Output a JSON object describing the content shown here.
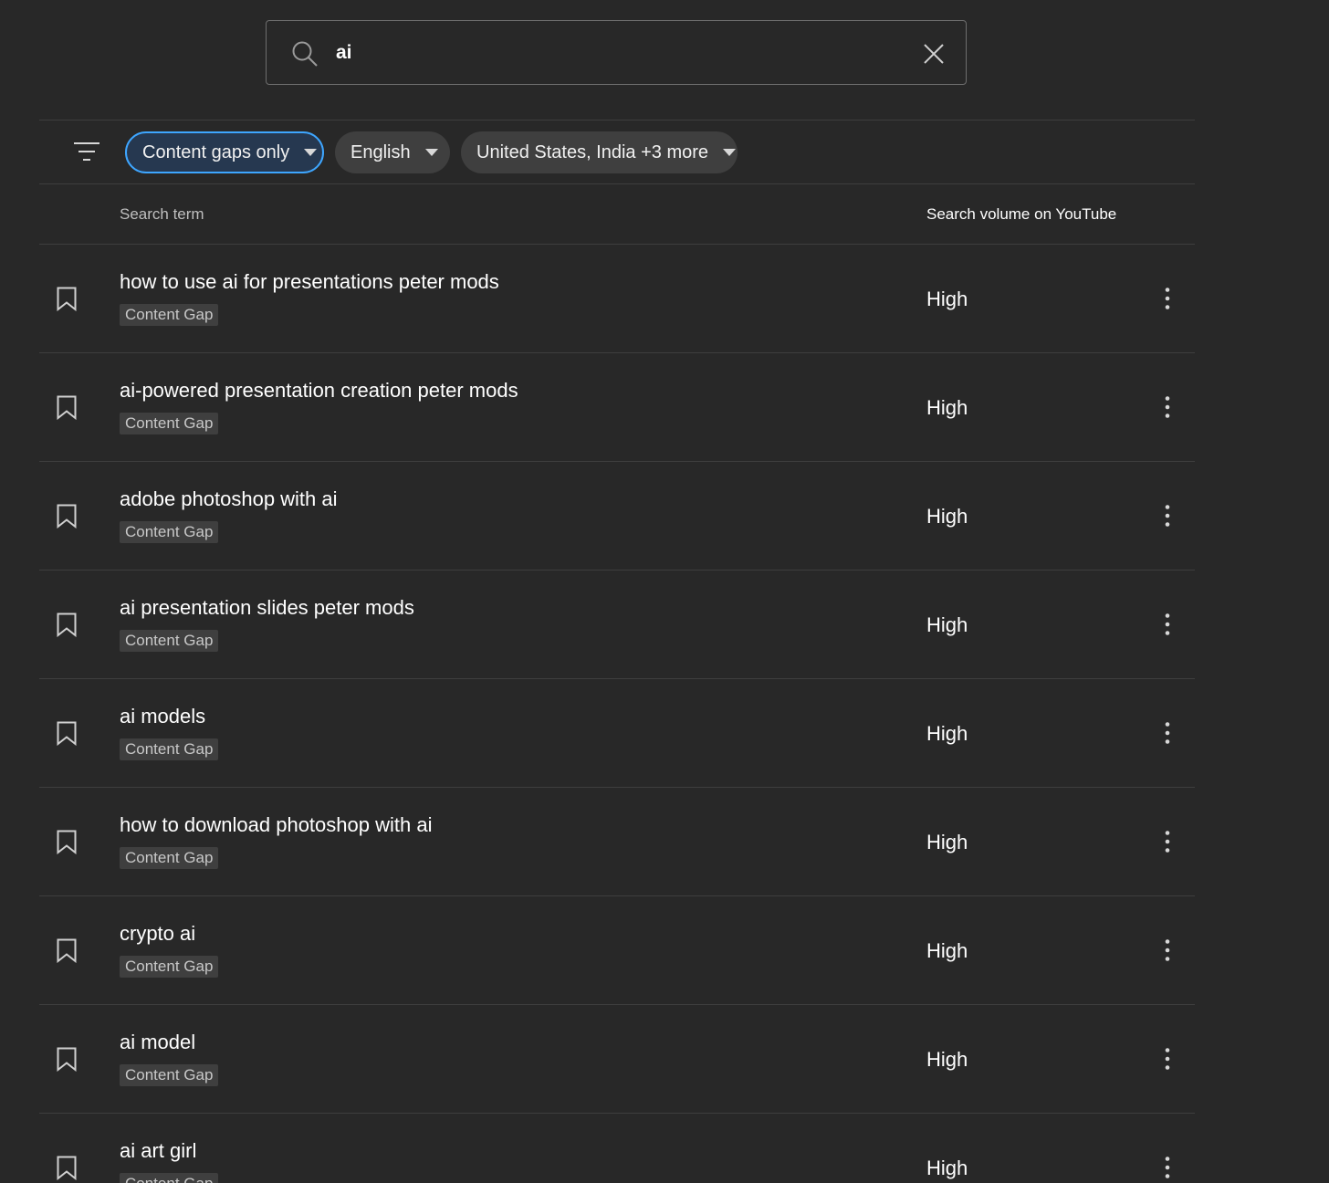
{
  "search": {
    "value": "ai",
    "placeholder": ""
  },
  "filters": {
    "chips": [
      {
        "label": "Content gaps only",
        "active": true
      },
      {
        "label": "English",
        "active": false
      },
      {
        "label": "United States, India +3 more",
        "active": false
      }
    ]
  },
  "table": {
    "columns": {
      "term": "Search term",
      "volume": "Search volume on YouTube"
    },
    "rows": [
      {
        "term": "how to use ai for presentations peter mods",
        "badge": "Content Gap",
        "volume": "High"
      },
      {
        "term": "ai-powered presentation creation peter mods",
        "badge": "Content Gap",
        "volume": "High"
      },
      {
        "term": "adobe photoshop with ai",
        "badge": "Content Gap",
        "volume": "High"
      },
      {
        "term": "ai presentation slides peter mods",
        "badge": "Content Gap",
        "volume": "High"
      },
      {
        "term": "ai models",
        "badge": "Content Gap",
        "volume": "High"
      },
      {
        "term": "how to download photoshop with ai",
        "badge": "Content Gap",
        "volume": "High"
      },
      {
        "term": "crypto ai",
        "badge": "Content Gap",
        "volume": "High"
      },
      {
        "term": "ai model",
        "badge": "Content Gap",
        "volume": "High"
      },
      {
        "term": "ai art girl",
        "badge": "Content Gap",
        "volume": "High"
      }
    ]
  },
  "icons": {
    "search": "search-icon",
    "clear": "close-icon",
    "filter": "filter-icon",
    "bookmark": "bookmark-icon",
    "more": "more-vert-icon"
  },
  "colors": {
    "background": "#282828",
    "chip": "#3f3f3f",
    "active_chip_border": "#3ea6ff",
    "divider": "#3e3e3e"
  }
}
